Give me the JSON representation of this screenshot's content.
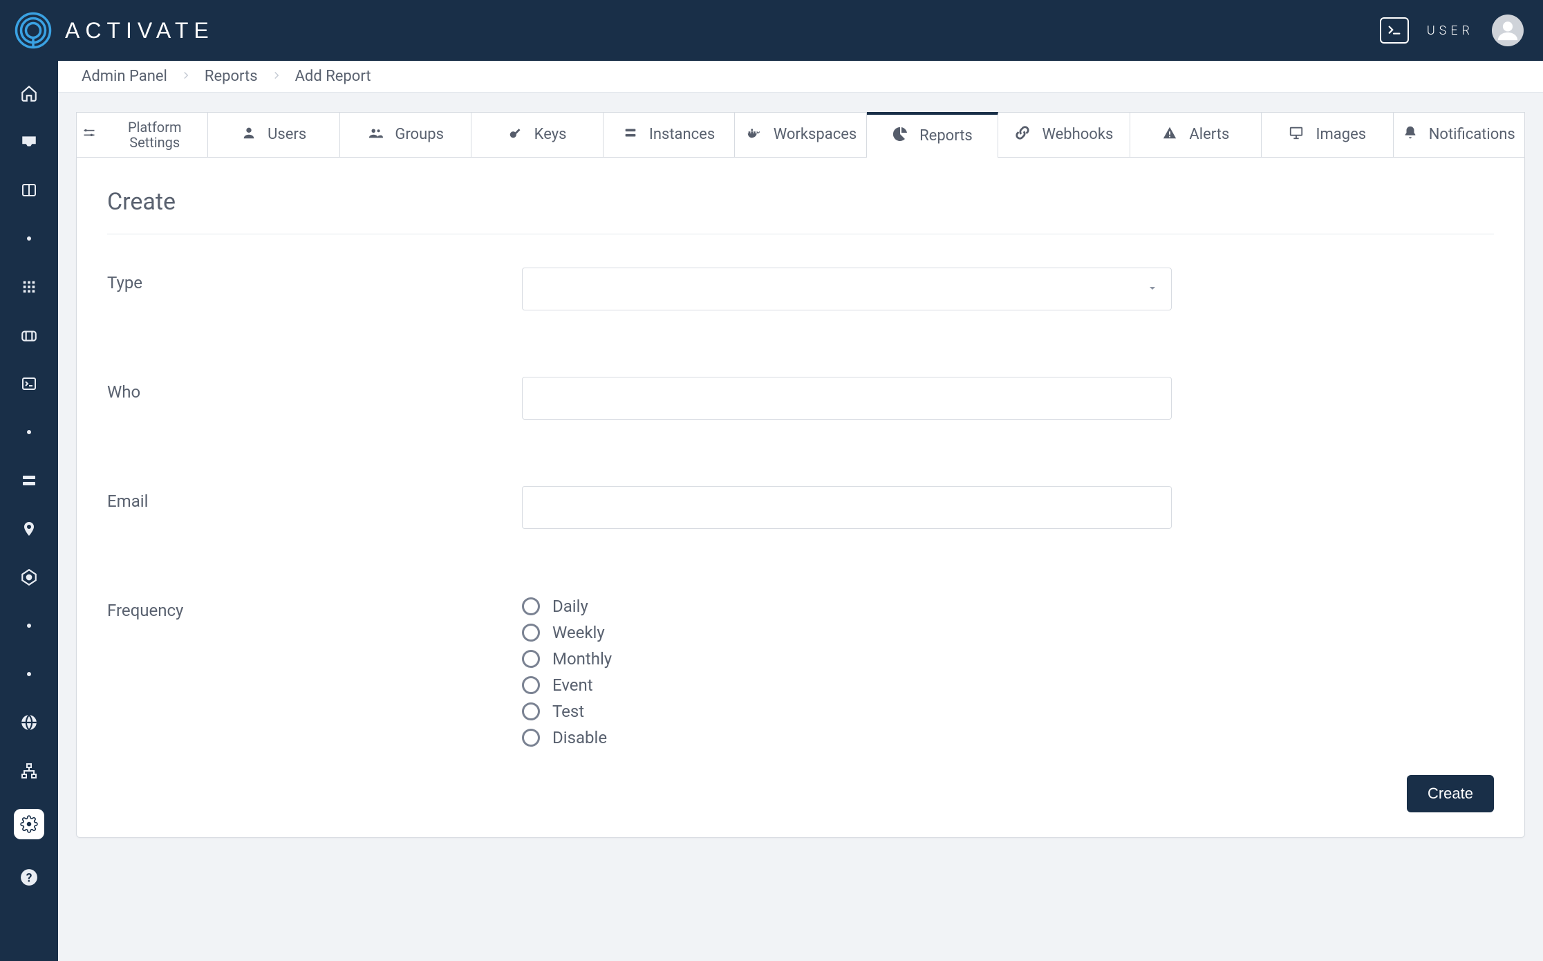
{
  "header": {
    "brand": "ACTIVATE",
    "user_label": "USER"
  },
  "breadcrumbs": [
    "Admin Panel",
    "Reports",
    "Add Report"
  ],
  "tabs": [
    {
      "label": "Platform Settings",
      "icon": "sliders"
    },
    {
      "label": "Users",
      "icon": "user"
    },
    {
      "label": "Groups",
      "icon": "group"
    },
    {
      "label": "Keys",
      "icon": "key"
    },
    {
      "label": "Instances",
      "icon": "stack"
    },
    {
      "label": "Workspaces",
      "icon": "docker"
    },
    {
      "label": "Reports",
      "icon": "piechart",
      "active": true
    },
    {
      "label": "Webhooks",
      "icon": "link"
    },
    {
      "label": "Alerts",
      "icon": "alert"
    },
    {
      "label": "Images",
      "icon": "monitor"
    },
    {
      "label": "Notifications",
      "icon": "bell"
    }
  ],
  "panel": {
    "title": "Create",
    "fields": {
      "type_label": "Type",
      "type_value": "",
      "who_label": "Who",
      "who_value": "",
      "email_label": "Email",
      "email_value": "",
      "frequency_label": "Frequency"
    },
    "frequency_options": [
      "Daily",
      "Weekly",
      "Monthly",
      "Event",
      "Test",
      "Disable"
    ],
    "submit_label": "Create"
  }
}
